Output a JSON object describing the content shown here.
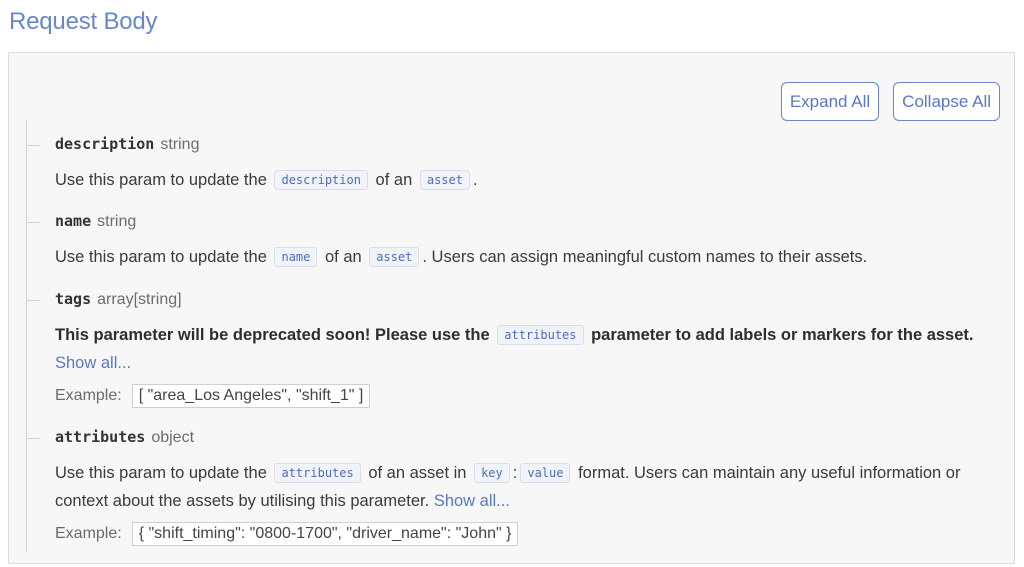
{
  "section_title": "Request Body",
  "toolbar": {
    "expand_label": "Expand All",
    "collapse_label": "Collapse All"
  },
  "params": {
    "description": {
      "name": "description",
      "type": "string",
      "text_1": "Use this param to update the",
      "code_1": "description",
      "text_2": "of an",
      "code_2": "asset",
      "text_3": "."
    },
    "name": {
      "name": "name",
      "type": "string",
      "text_1": "Use this param to update the",
      "code_1": "name",
      "text_2": "of an",
      "code_2": "asset",
      "text_3": ". Users can assign meaningful custom names to their assets."
    },
    "tags": {
      "name": "tags",
      "type": "array[string]",
      "text_1": "This parameter will be deprecated soon! Please use the",
      "code_1": "attributes",
      "text_2": "parameter to add labels or markers for the asset.",
      "show_all": "Show all...",
      "example_label": "Example:",
      "example_value": "[ \"area_Los Angeles\", \"shift_1\" ]"
    },
    "attributes": {
      "name": "attributes",
      "type": "object",
      "text_1": "Use this param to update the",
      "code_1": "attributes",
      "text_2": "of an asset in",
      "code_2": "key",
      "sep": ":",
      "code_3": "value",
      "text_3": "format. Users can maintain any useful information or context about the assets by utilising this parameter.",
      "show_all": "Show all...",
      "example_label": "Example:",
      "example_value": "{ \"shift_timing\": \"0800-1700\", \"driver_name\": \"John\" }"
    }
  }
}
